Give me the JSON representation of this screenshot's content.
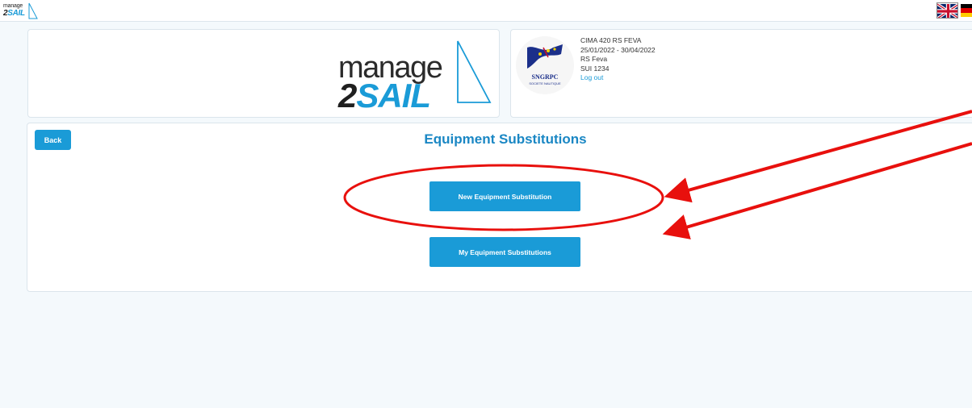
{
  "header": {
    "mini_logo": {
      "word1": "manage",
      "word2a": "2",
      "word2b": "SAIL"
    },
    "languages": [
      {
        "name": "uk-flag-icon"
      },
      {
        "name": "de-flag-icon"
      }
    ]
  },
  "logo": {
    "word1": "manage",
    "word2a": "2",
    "word2b": "SAIL"
  },
  "club_logo": {
    "name": "SNGRPC",
    "sub": "SOCIETE NAUTIQUE"
  },
  "event": {
    "name": "CIMA 420 RS FEVA",
    "dates": "25/01/2022 - 30/04/2022",
    "class": "RS Feva",
    "sail_number": "SUI 1234",
    "logout_label": "Log out"
  },
  "main": {
    "back_label": "Back",
    "title": "Equipment Substitutions",
    "new_button": "New Equipment Substitution",
    "my_button": "My Equipment Substitutions"
  },
  "colors": {
    "accent": "#1a9bd7",
    "title": "#1a87c4",
    "annotation": "#e8100d"
  }
}
